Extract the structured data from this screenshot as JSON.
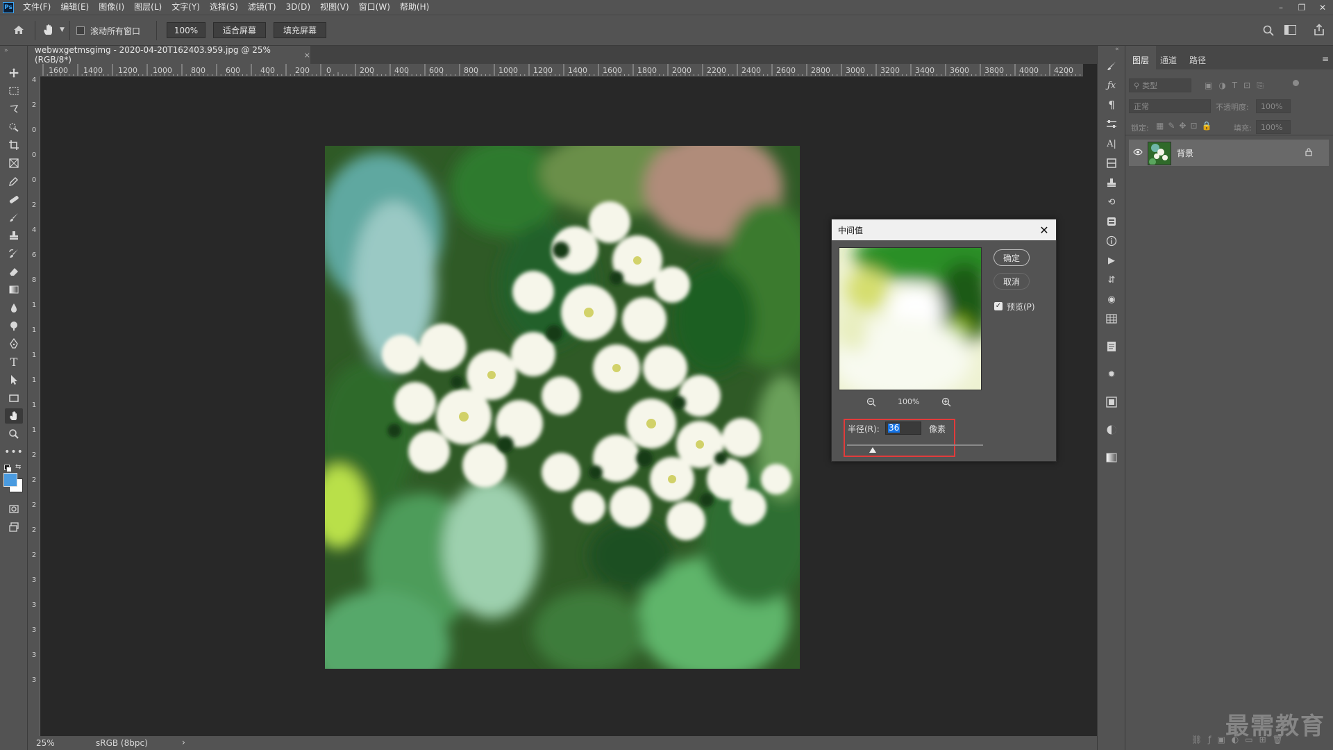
{
  "app": {
    "logo": "Ps"
  },
  "menu": [
    "文件(F)",
    "编辑(E)",
    "图像(I)",
    "图层(L)",
    "文字(Y)",
    "选择(S)",
    "滤镜(T)",
    "3D(D)",
    "视图(V)",
    "窗口(W)",
    "帮助(H)"
  ],
  "window_controls": {
    "minimize": "–",
    "restore": "❐",
    "close": "✕"
  },
  "options": {
    "scroll_all_label": "滚动所有窗口",
    "scroll_all_checked": false,
    "zoom_btn": "100%",
    "fit_screen": "适合屏幕",
    "fill_screen": "填充屏幕"
  },
  "document": {
    "tab_title": "webwxgetmsgimg - 2020-04-20T162403.959.jpg @ 25%(RGB/8*)",
    "close": "×"
  },
  "rulers": {
    "horizontal": [
      "1600",
      "1400",
      "1200",
      "1000",
      "800",
      "600",
      "400",
      "200",
      "0",
      "200",
      "400",
      "600",
      "800",
      "1000",
      "1200",
      "1400",
      "1600",
      "1800",
      "2000",
      "2200",
      "2400",
      "2600",
      "2800",
      "3000",
      "3200",
      "3400",
      "3600",
      "3800",
      "4000",
      "4200"
    ],
    "vertical": [
      "4",
      "2",
      "0",
      "0",
      "0",
      "2",
      "4",
      "6",
      "8",
      "1",
      "1",
      "1",
      "1",
      "1",
      "1",
      "2",
      "2",
      "2",
      "2",
      "2",
      "3",
      "3",
      "3",
      "3",
      "3"
    ]
  },
  "status": {
    "zoom": "25%",
    "profile": "sRGB (8bpc)",
    "arrow": "›"
  },
  "layers_panel": {
    "tabs": [
      "图层",
      "通道",
      "路径"
    ],
    "filter_placeholder": "类型",
    "blend_mode": "正常",
    "opacity_label": "不透明度:",
    "opacity_value": "100%",
    "lock_label": "锁定:",
    "fill_label": "填充:",
    "fill_value": "100%",
    "layer_name": "背景"
  },
  "dialog": {
    "title": "中间值",
    "ok": "确定",
    "cancel": "取消",
    "preview_label": "预览(P)",
    "preview_checked": true,
    "zoom_value": "100%",
    "radius_label": "半径(R):",
    "radius_value": "36",
    "radius_unit": "像素",
    "radius_slider_fraction": 0.19
  },
  "watermark": "最需教育",
  "colors": {
    "highlight_box": "#e23b3b",
    "foreground": "#4a9be0",
    "background": "#ffffff"
  }
}
